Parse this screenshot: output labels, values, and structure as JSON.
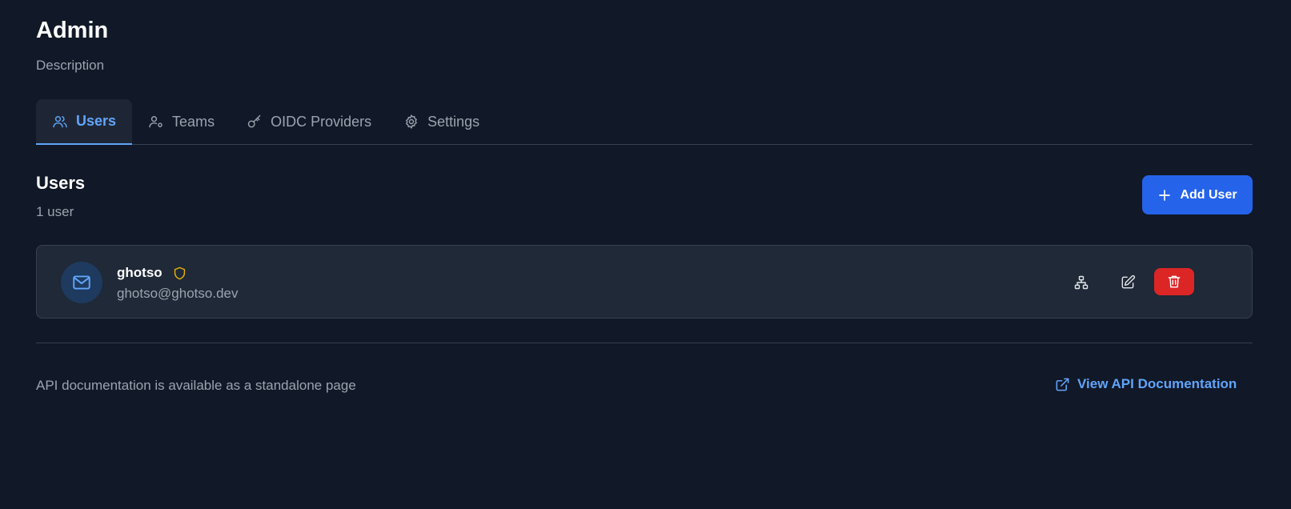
{
  "header": {
    "title": "Admin",
    "description": "Description"
  },
  "tabs": [
    {
      "label": "Users",
      "icon": "users-icon",
      "active": true
    },
    {
      "label": "Teams",
      "icon": "user-cog-icon",
      "active": false
    },
    {
      "label": "OIDC Providers",
      "icon": "key-icon",
      "active": false
    },
    {
      "label": "Settings",
      "icon": "gear-icon",
      "active": false
    }
  ],
  "users_section": {
    "title": "Users",
    "count": "1 user",
    "add_label": "Add User"
  },
  "users": [
    {
      "name": "ghotso",
      "email": "ghotso@ghotso.dev",
      "avatar_icon": "mail-icon",
      "badge_icon": "shield-icon"
    }
  ],
  "footer": {
    "text": "API documentation is available as a standalone page",
    "link_label": "View API Documentation",
    "link_icon": "external-link-icon"
  },
  "colors": {
    "background": "#111827",
    "card": "#1f2937",
    "accent": "#60a5fa",
    "primary_button": "#2563eb",
    "danger": "#dc2626",
    "admin_badge": "#eab308"
  }
}
